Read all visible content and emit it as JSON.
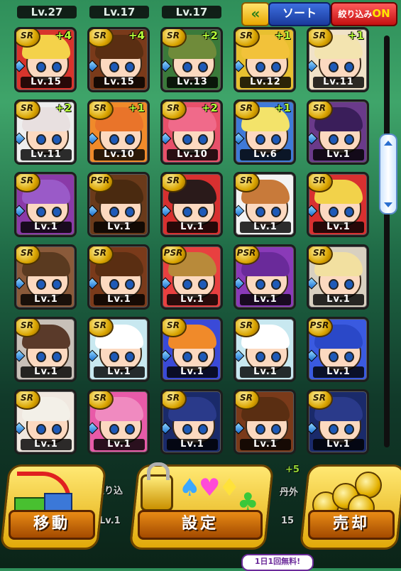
{
  "header": {
    "partial_levels": [
      "Lv.27",
      "Lv.17",
      "Lv.17"
    ],
    "back_icon": "double-chevron-left",
    "sort_label": "ソート",
    "filter_label": "絞り込み",
    "filter_state": "ON"
  },
  "cards": [
    {
      "rarity": "SR",
      "plus": "+4",
      "level": "Lv.15",
      "bg": "#d8342c",
      "hair": "#f4d24a"
    },
    {
      "rarity": "SR",
      "plus": "+4",
      "level": "Lv.15",
      "bg": "#7a3a1a",
      "hair": "#5a2e12"
    },
    {
      "rarity": "SR",
      "plus": "+2",
      "level": "Lv.13",
      "bg": "#3a7a3a",
      "hair": "#6f8b3a"
    },
    {
      "rarity": "SR",
      "plus": "+1",
      "level": "Lv.12",
      "bg": "#e8c030",
      "hair": "#f2c23a"
    },
    {
      "rarity": "SR",
      "plus": "+1",
      "level": "Lv.11",
      "bg": "#f0e2c8",
      "hair": "#f3e4b0"
    },
    {
      "rarity": "SR",
      "plus": "+2",
      "level": "Lv.11",
      "bg": "#eeeeee",
      "hair": "#e8e0e0"
    },
    {
      "rarity": "SR",
      "plus": "+1",
      "level": "Lv.10",
      "bg": "#f08a2a",
      "hair": "#e9742a"
    },
    {
      "rarity": "SR",
      "plus": "+2",
      "level": "Lv.10",
      "bg": "#e8506a",
      "hair": "#f06a8a"
    },
    {
      "rarity": "SR",
      "plus": "+1",
      "level": "Lv.6",
      "bg": "#3f7ad8",
      "hair": "#f3e36a"
    },
    {
      "rarity": "SR",
      "plus": "",
      "level": "Lv.1",
      "bg": "#6a3a8a",
      "hair": "#3a1e5a"
    },
    {
      "rarity": "SR",
      "plus": "",
      "level": "Lv.1",
      "bg": "#8a3aa8",
      "hair": "#9a5ac8"
    },
    {
      "rarity": "PSR",
      "plus": "",
      "level": "Lv.1",
      "bg": "#6a3a1a",
      "hair": "#4a2a10"
    },
    {
      "rarity": "SR",
      "plus": "",
      "level": "Lv.1",
      "bg": "#d83030",
      "hair": "#2a1a1a"
    },
    {
      "rarity": "SR",
      "plus": "",
      "level": "Lv.1",
      "bg": "#f3f3f3",
      "hair": "#c87a3a"
    },
    {
      "rarity": "SR",
      "plus": "",
      "level": "Lv.1",
      "bg": "#d83030",
      "hair": "#f2d24a"
    },
    {
      "rarity": "SR",
      "plus": "",
      "level": "Lv.1",
      "bg": "#8a5a3a",
      "hair": "#5a3a20"
    },
    {
      "rarity": "SR",
      "plus": "",
      "level": "Lv.1",
      "bg": "#7a3a1a",
      "hair": "#5a2e12"
    },
    {
      "rarity": "PSR",
      "plus": "",
      "level": "Lv.1",
      "bg": "#e84040",
      "hair": "#b88a3a"
    },
    {
      "rarity": "PSR",
      "plus": "",
      "level": "Lv.1",
      "bg": "#8a3ab8",
      "hair": "#6a2a9a"
    },
    {
      "rarity": "SR",
      "plus": "",
      "level": "Lv.1",
      "bg": "#d8d0c0",
      "hair": "#f2e0a0"
    },
    {
      "rarity": "SR",
      "plus": "",
      "level": "Lv.1",
      "bg": "#c8c0b8",
      "hair": "#5a3a2a"
    },
    {
      "rarity": "SR",
      "plus": "",
      "level": "Lv.1",
      "bg": "#c8e8f0",
      "hair": "#ffffff"
    },
    {
      "rarity": "SR",
      "plus": "",
      "level": "Lv.1",
      "bg": "#3a4ad8",
      "hair": "#f08a2a"
    },
    {
      "rarity": "SR",
      "plus": "",
      "level": "Lv.1",
      "bg": "#c8e8f0",
      "hair": "#ffffff"
    },
    {
      "rarity": "PSR",
      "plus": "",
      "level": "Lv.1",
      "bg": "#3a5ae0",
      "hair": "#2a48c8"
    },
    {
      "rarity": "SR",
      "plus": "",
      "level": "Lv.1",
      "bg": "#f0e8e0",
      "hair": "#f3f0e8"
    },
    {
      "rarity": "SR",
      "plus": "",
      "level": "Lv.1",
      "bg": "#e85aa8",
      "hair": "#f08ac0"
    },
    {
      "rarity": "SR",
      "plus": "",
      "level": "Lv.1",
      "bg": "#1a2a6a",
      "hair": "#2a3a8a"
    },
    {
      "rarity": "SR",
      "plus": "",
      "level": "Lv.1",
      "bg": "#7a3a1a",
      "hair": "#5a2e12"
    },
    {
      "rarity": "SR",
      "plus": "",
      "level": "Lv.1",
      "bg": "#1a2a6a",
      "hair": "#2a3a8a"
    }
  ],
  "bottom": {
    "peek_left": "絞り込",
    "peek_lv": "Lv.1",
    "peek_plus": "+5",
    "peek_right": "丹外",
    "peek_num": "15",
    "move_label": "移動",
    "settings_label": "設定",
    "sell_label": "売却",
    "free_badge": "1日1回無料!"
  },
  "icons": {
    "move": "arrow-boxes-icon",
    "settings": "lock-suits-icon",
    "sell": "coins-icon"
  }
}
